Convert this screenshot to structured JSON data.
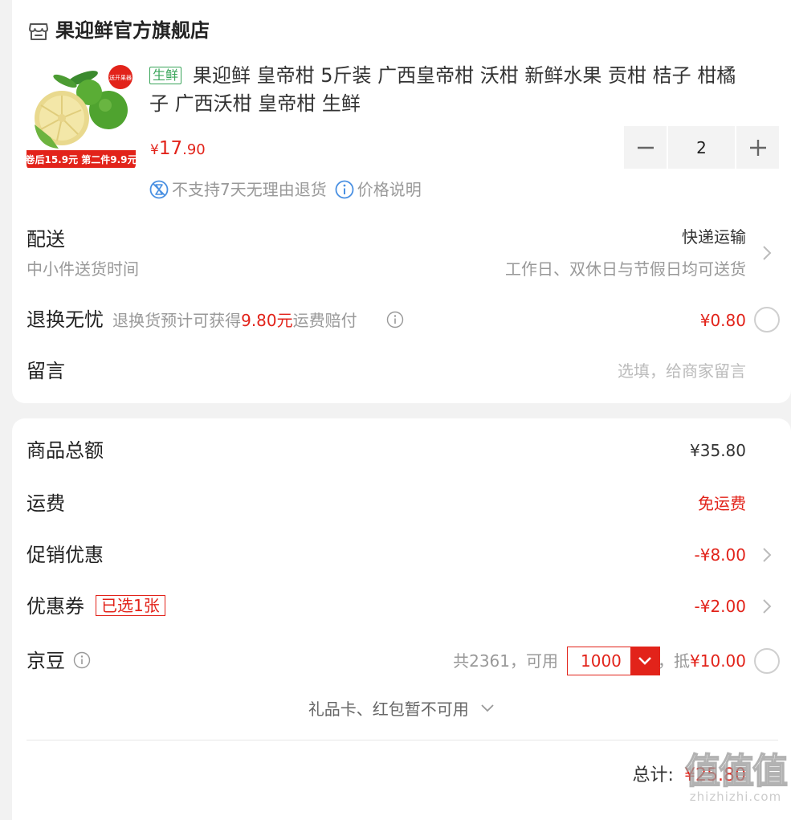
{
  "store": {
    "name": "果迎鲜官方旗舰店",
    "icon": "store-icon"
  },
  "product": {
    "image_icon": "orange-citrus-image",
    "image_badge_text": "送开果器",
    "image_banner_text": "卷后15.9元 第二件9.9元",
    "tag": "生鲜",
    "title_line1": "果迎鲜 皇帝柑 5斤装 广西皇帝柑 沃柑 新鲜水果 贡柑 桔子 柑橘",
    "title_line2": "子 广西沃柑 皇帝柑 生鲜",
    "price_symbol": "¥",
    "price_int": "17",
    "price_dec": ".90",
    "quantity": "2",
    "minus_label": "−",
    "plus_label": "+",
    "policy_return": "不支持7天无理由退货",
    "policy_price": "价格说明"
  },
  "delivery": {
    "label": "配送",
    "sub": "中小件送货时间",
    "method": "快递运输",
    "time": "工作日、双休日与节假日均可送货"
  },
  "return_insurance": {
    "label": "退换无忧",
    "desc_prefix": "退换货预计可获得",
    "desc_amount": "9.80元",
    "desc_suffix": "运费赔付",
    "price": "¥0.80"
  },
  "message": {
    "label": "留言",
    "placeholder": "选填，给商家留言"
  },
  "summary": {
    "goods_total_label": "商品总额",
    "goods_total_value": "¥35.80",
    "shipping_label": "运费",
    "shipping_value": "免运费",
    "promo_label": "促销优惠",
    "promo_value": "-¥8.00",
    "coupon_label": "优惠券",
    "coupon_tag": "已选1张",
    "coupon_value": "-¥2.00",
    "beans_label": "京豆",
    "beans_total": "共2361，可用",
    "beans_selected": "1000",
    "beans_deduct": "，抵",
    "beans_deduct_value": "¥10.00",
    "giftcard_note": "礼品卡、红包暂不可用",
    "total_label": "总计:",
    "total_value": "¥25.80"
  },
  "watermark": {
    "big": "值值值",
    "small": "zhizhizhi.com"
  },
  "colors": {
    "accent_red": "#e2231a",
    "fresh_green": "#3aa55a",
    "info_blue": "#4a90e2",
    "background": "#f2f2f2"
  }
}
